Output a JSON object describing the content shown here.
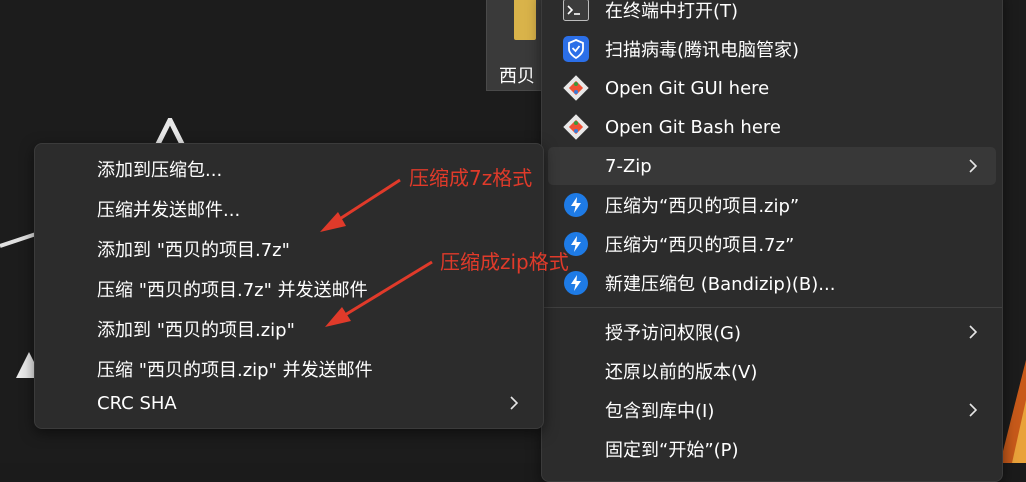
{
  "desktop": {
    "folder_label": "西贝"
  },
  "left_menu": {
    "items": [
      {
        "label": "添加到压缩包..."
      },
      {
        "label": "压缩并发送邮件..."
      },
      {
        "label": "添加到 \"西贝的项目.7z\""
      },
      {
        "label": "压缩 \"西贝的项目.7z\" 并发送邮件"
      },
      {
        "label": "添加到 \"西贝的项目.zip\""
      },
      {
        "label": "压缩 \"西贝的项目.zip\" 并发送邮件"
      },
      {
        "label": "CRC SHA",
        "submenu": true
      }
    ]
  },
  "right_menu": {
    "items": [
      {
        "label": "在终端中打开(T)",
        "icon": "terminal-icon"
      },
      {
        "label": "扫描病毒(腾讯电脑管家)",
        "icon": "tencent-shield-icon"
      },
      {
        "label": "Open Git GUI here",
        "icon": "git-icon"
      },
      {
        "label": "Open Git Bash here",
        "icon": "git-icon"
      },
      {
        "label": "7-Zip",
        "submenu": true,
        "highlighted": true
      },
      {
        "label": "压缩为“西贝的项目.zip”",
        "icon": "bandizip-icon"
      },
      {
        "label": "压缩为“西贝的项目.7z”",
        "icon": "bandizip-icon"
      },
      {
        "label": "新建压缩包 (Bandizip)(B)...",
        "icon": "bandizip-icon"
      },
      {
        "label": "授予访问权限(G)",
        "submenu": true
      },
      {
        "label": "还原以前的版本(V)"
      },
      {
        "label": "包含到库中(I)",
        "submenu": true
      },
      {
        "label": "固定到“开始”(P)"
      }
    ]
  },
  "annotations": {
    "label_7z": "压缩成7z格式",
    "label_zip": "压缩成zip格式",
    "color": "#e03a2a"
  },
  "colors": {
    "menu_bg": "#2c2c2c",
    "hover_bg": "#383838",
    "bandizip_blue": "#1e7be6",
    "tencent_blue": "#2b6fe8"
  }
}
